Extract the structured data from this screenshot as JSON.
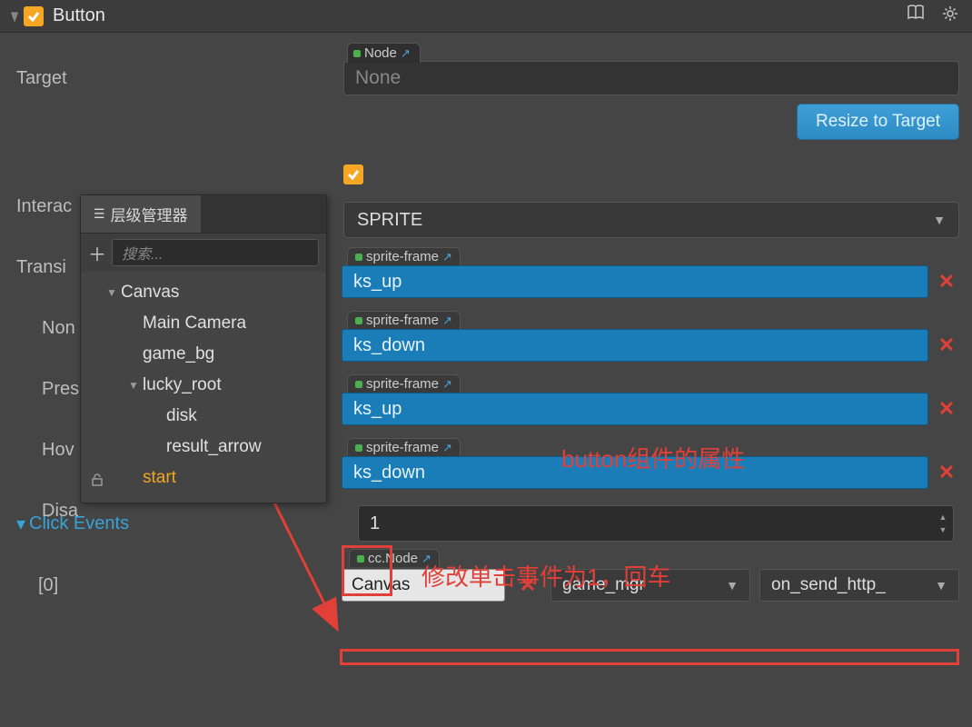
{
  "header": {
    "title": "Button"
  },
  "labels": {
    "target": "Target",
    "interactable": "Interactable",
    "transition": "Transition",
    "normal": "Normal",
    "pressed": "Pressed",
    "hover": "Hover",
    "disabled": "Disabled",
    "click_events": "Click Events",
    "index0": "[0]"
  },
  "target_slot": {
    "type": "Node",
    "value": "None"
  },
  "resize_btn": "Resize to Target",
  "transition_select": "SPRITE",
  "sprites": [
    {
      "type": "sprite-frame",
      "value": "ks_up"
    },
    {
      "type": "sprite-frame",
      "value": "ks_down"
    },
    {
      "type": "sprite-frame",
      "value": "ks_up"
    },
    {
      "type": "sprite-frame",
      "value": "ks_down"
    }
  ],
  "click_events_count": "1",
  "event0": {
    "node_type": "cc.Node",
    "node_value": "Canvas",
    "component": "game_mgr",
    "handler": "on_send_http_"
  },
  "hierarchy": {
    "title": "层级管理器",
    "search_placeholder": "搜索...",
    "items": [
      {
        "name": "Canvas",
        "depth": 0,
        "caret": true
      },
      {
        "name": "Main Camera",
        "depth": 1,
        "caret": false
      },
      {
        "name": "game_bg",
        "depth": 1,
        "caret": false
      },
      {
        "name": "lucky_root",
        "depth": 1,
        "caret": true
      },
      {
        "name": "disk",
        "depth": 2,
        "caret": false
      },
      {
        "name": "result_arrow",
        "depth": 2,
        "caret": false
      },
      {
        "name": "start",
        "depth": 1,
        "caret": false,
        "selected": true
      }
    ]
  },
  "annotations": {
    "text1": "button组件的属性",
    "text2": "修改单击事件为1，回车"
  }
}
